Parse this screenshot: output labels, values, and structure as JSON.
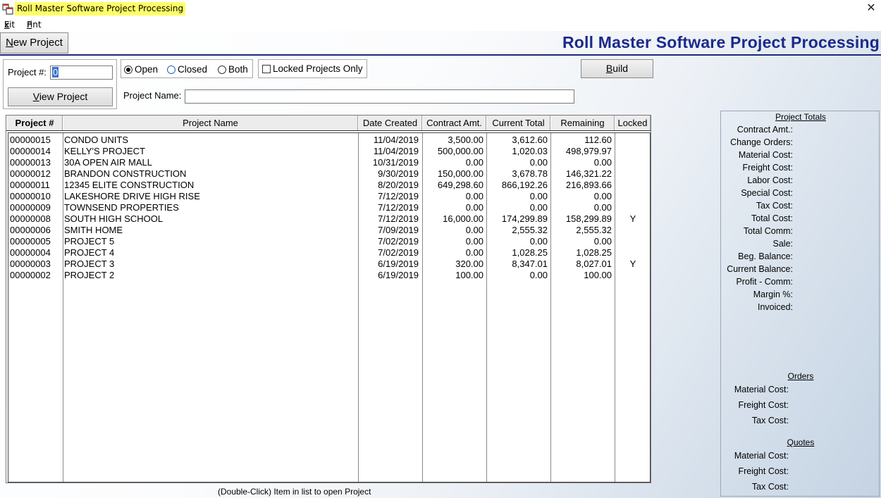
{
  "window": {
    "title": "Roll Master Software Project Processing",
    "close_glyph": "✕",
    "icon": "app-window-icon"
  },
  "menu": {
    "exit_u": "E",
    "exit_rest": "xit",
    "print_u": "P",
    "print_rest": "rint"
  },
  "header": {
    "new_project_u": "N",
    "new_project_rest": "ew Project",
    "heading": "Roll Master Software Project Processing"
  },
  "filters": {
    "project_num_label": "Project #:",
    "project_num_value": "0",
    "view_project_u": "V",
    "view_project_rest": "iew Project",
    "radio_open": "Open",
    "radio_closed": "Closed",
    "radio_both": "Both",
    "selected_status": "Open",
    "locked_only_label": "Locked Projects Only",
    "locked_only_checked": false,
    "build_u": "B",
    "build_rest": "uild",
    "project_name_label": "Project Name:",
    "project_name_value": ""
  },
  "grid": {
    "columns": [
      "Project #",
      "Project Name",
      "Date Created",
      "Contract Amt.",
      "Current Total",
      "Remaining",
      "Locked"
    ],
    "rows": [
      [
        "00000015",
        "CONDO UNITS",
        "11/04/2019",
        "3,500.00",
        "3,612.60",
        "112.60",
        ""
      ],
      [
        "00000014",
        "KELLY'S PROJECT",
        "11/04/2019",
        "500,000.00",
        "1,020.03",
        "498,979.97",
        ""
      ],
      [
        "00000013",
        "30A OPEN AIR MALL",
        "10/31/2019",
        "0.00",
        "0.00",
        "0.00",
        ""
      ],
      [
        "00000012",
        "BRANDON CONSTRUCTION",
        "9/30/2019",
        "150,000.00",
        "3,678.78",
        "146,321.22",
        ""
      ],
      [
        "00000011",
        "12345 ELITE CONSTRUCTION",
        "8/20/2019",
        "649,298.60",
        "866,192.26",
        "216,893.66",
        ""
      ],
      [
        "00000010",
        "LAKESHORE DRIVE HIGH RISE",
        "7/12/2019",
        "0.00",
        "0.00",
        "0.00",
        ""
      ],
      [
        "00000009",
        "TOWNSEND PROPERTIES",
        "7/12/2019",
        "0.00",
        "0.00",
        "0.00",
        ""
      ],
      [
        "00000008",
        "SOUTH HIGH SCHOOL",
        "7/12/2019",
        "16,000.00",
        "174,299.89",
        "158,299.89",
        "Y"
      ],
      [
        "00000006",
        "SMITH HOME",
        "7/09/2019",
        "0.00",
        "2,555.32",
        "2,555.32",
        ""
      ],
      [
        "00000005",
        "PROJECT 5",
        "7/02/2019",
        "0.00",
        "0.00",
        "0.00",
        ""
      ],
      [
        "00000004",
        "PROJECT 4",
        "7/02/2019",
        "0.00",
        "1,028.25",
        "1,028.25",
        ""
      ],
      [
        "00000003",
        "PROJECT 3",
        "6/19/2019",
        "320.00",
        "8,347.01",
        "8,027.01",
        "Y"
      ],
      [
        "00000002",
        "PROJECT 2",
        "6/19/2019",
        "100.00",
        "0.00",
        "100.00",
        ""
      ]
    ],
    "hint": "(Double-Click) Item in list to open Project"
  },
  "totals": {
    "project_totals_title": "Project Totals",
    "project_totals_labels": [
      "Contract Amt.:",
      "Change Orders:",
      "Material Cost:",
      "Freight Cost:",
      "Labor Cost:",
      "Special Cost:",
      "Tax Cost:",
      "Total Cost:",
      "Total Comm:",
      "Sale:",
      "Beg. Balance:",
      "Current Balance:",
      "Profit - Comm:",
      "Margin %:",
      "Invoiced:"
    ],
    "orders_title": "Orders",
    "orders_labels": [
      "Material Cost:",
      "Freight Cost:",
      "Tax Cost:"
    ],
    "quotes_title": "Quotes",
    "quotes_labels": [
      "Material Cost:",
      "Freight Cost:",
      "Tax Cost:"
    ]
  }
}
